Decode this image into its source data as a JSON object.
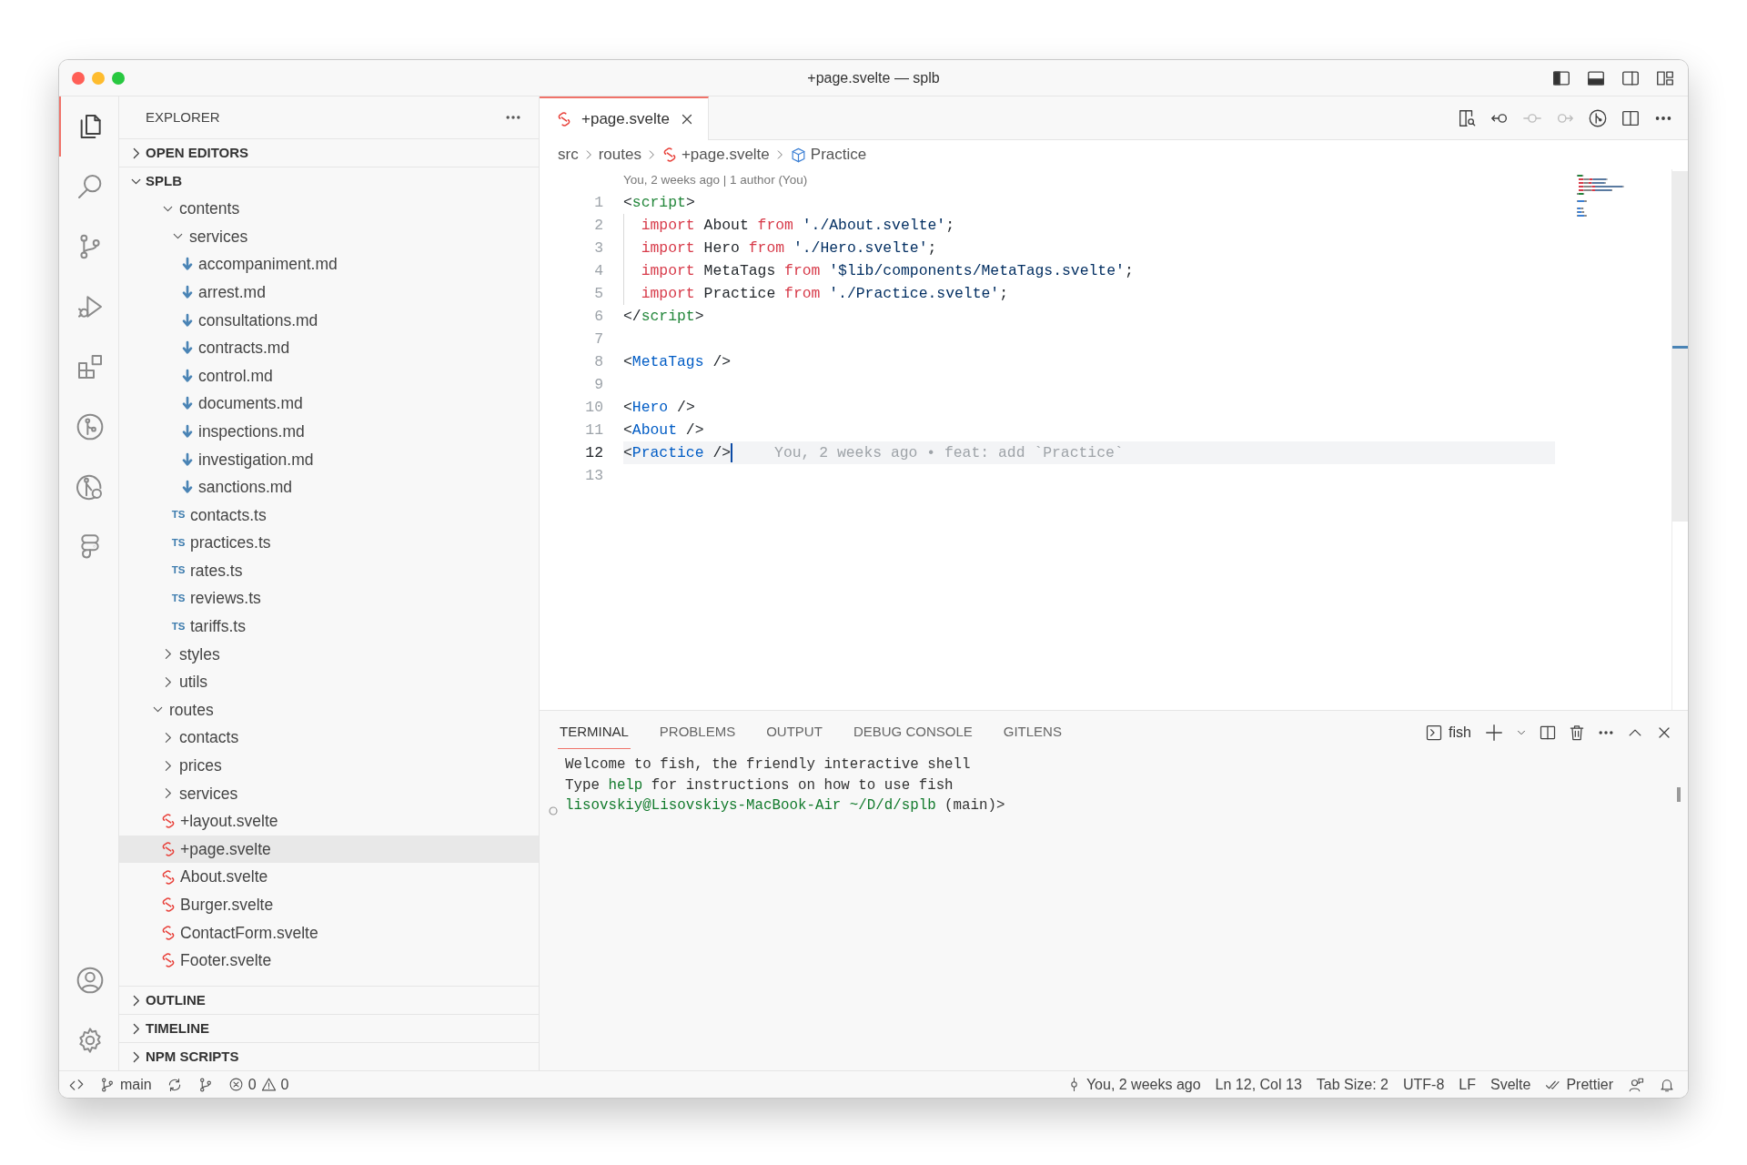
{
  "window": {
    "title": "+page.svelte — splb",
    "controls": [
      {
        "kind": "close"
      },
      {
        "kind": "minimize"
      },
      {
        "kind": "zoom"
      }
    ],
    "layout_actions": [
      {
        "kind": "sidebar",
        "on": true
      },
      {
        "kind": "panel",
        "on": true
      },
      {
        "kind": "secondary",
        "on": false
      },
      {
        "kind": "customize"
      }
    ]
  },
  "activity_bar": {
    "items": [
      {
        "kind": "explorer",
        "selected": true
      },
      {
        "kind": "search",
        "selected": false
      },
      {
        "kind": "source-control",
        "selected": false
      },
      {
        "kind": "run",
        "selected": false
      },
      {
        "kind": "extensions",
        "selected": false
      },
      {
        "kind": "git-graph",
        "selected": false
      },
      {
        "kind": "remote",
        "selected": false
      },
      {
        "kind": "shapes",
        "selected": false
      }
    ],
    "bottom": [
      {
        "kind": "account"
      },
      {
        "kind": "settings"
      }
    ]
  },
  "sidebar": {
    "title": "EXPLORER",
    "sections": [
      {
        "label": "OPEN EDITORS",
        "expanded": false
      },
      {
        "label": "SPLB",
        "expanded": true,
        "tree": [
          {
            "children": [
              {
                "label": "contents",
                "kind": "folder",
                "expanded": true,
                "selected": false,
                "children": [
                  {
                    "label": "services",
                    "kind": "folder",
                    "expanded": true,
                    "selected": false,
                    "children": [
                      {
                        "label": "accompaniment.md",
                        "kind": "markdown",
                        "selected": false
                      },
                      {
                        "label": "arrest.md",
                        "kind": "markdown",
                        "selected": false
                      },
                      {
                        "label": "consultations.md",
                        "kind": "markdown",
                        "selected": false
                      },
                      {
                        "label": "contracts.md",
                        "kind": "markdown",
                        "selected": false
                      },
                      {
                        "label": "control.md",
                        "kind": "markdown",
                        "selected": false
                      },
                      {
                        "label": "documents.md",
                        "kind": "markdown",
                        "selected": false
                      },
                      {
                        "label": "inspections.md",
                        "kind": "markdown",
                        "selected": false
                      },
                      {
                        "label": "investigation.md",
                        "kind": "markdown",
                        "selected": false
                      },
                      {
                        "label": "sanctions.md",
                        "kind": "markdown",
                        "selected": false
                      }
                    ]
                  },
                  {
                    "label": "contacts.ts",
                    "kind": "typescript",
                    "badge": "TS",
                    "selected": false
                  },
                  {
                    "label": "practices.ts",
                    "kind": "typescript",
                    "badge": "TS",
                    "selected": false
                  },
                  {
                    "label": "rates.ts",
                    "kind": "typescript",
                    "badge": "TS",
                    "selected": false
                  },
                  {
                    "label": "reviews.ts",
                    "kind": "typescript",
                    "badge": "TS",
                    "selected": false
                  },
                  {
                    "label": "tariffs.ts",
                    "kind": "typescript",
                    "badge": "TS",
                    "selected": false
                  }
                ]
              },
              {
                "label": "styles",
                "kind": "folder",
                "expanded": false,
                "selected": false
              },
              {
                "label": "utils",
                "kind": "folder",
                "expanded": false,
                "selected": false
              }
            ]
          },
          {
            "label": "routes",
            "kind": "folder",
            "expanded": true,
            "selected": false,
            "children": [
              {
                "label": "contacts",
                "kind": "folder",
                "expanded": false,
                "selected": false
              },
              {
                "label": "prices",
                "kind": "folder",
                "expanded": false,
                "selected": false
              },
              {
                "label": "services",
                "kind": "folder",
                "expanded": false,
                "selected": false
              },
              {
                "label": "+layout.svelte",
                "kind": "svelte",
                "selected": false
              },
              {
                "label": "+page.svelte",
                "kind": "svelte",
                "selected": true
              },
              {
                "label": "About.svelte",
                "kind": "svelte",
                "selected": false
              },
              {
                "label": "Burger.svelte",
                "kind": "svelte",
                "selected": false
              },
              {
                "label": "ContactForm.svelte",
                "kind": "svelte",
                "selected": false
              },
              {
                "label": "Footer.svelte",
                "kind": "svelte",
                "selected": false
              }
            ]
          }
        ]
      },
      {
        "label": "OUTLINE",
        "expanded": false
      },
      {
        "label": "TIMELINE",
        "expanded": false
      },
      {
        "label": "NPM SCRIPTS",
        "expanded": false
      }
    ]
  },
  "editor": {
    "tabs": [
      {
        "label": "+page.svelte",
        "kind": "svelte",
        "selected": true
      }
    ],
    "actions": [
      {
        "kind": "preview",
        "disabled": false
      },
      {
        "kind": "back",
        "disabled": false
      },
      {
        "kind": "commit",
        "disabled": true
      },
      {
        "kind": "forward",
        "disabled": true
      },
      {
        "kind": "gitlens",
        "disabled": false
      },
      {
        "kind": "split",
        "disabled": false
      },
      {
        "kind": "more",
        "disabled": false
      }
    ],
    "breadcrumbs": [
      {
        "label": "src",
        "kind": "folder"
      },
      {
        "label": "routes",
        "kind": "folder"
      },
      {
        "label": "+page.svelte",
        "kind": "svelte"
      },
      {
        "label": "Practice",
        "kind": "component"
      }
    ],
    "blame_header": "You, 2 weeks ago | 1 author (You)",
    "lines": [
      {
        "number": "1",
        "indent": false,
        "current": false,
        "tokens": [
          {
            "kind": "punct",
            "text": "<"
          },
          {
            "kind": "tag",
            "text": "script"
          },
          {
            "kind": "punct",
            "text": ">"
          }
        ]
      },
      {
        "number": "2",
        "indent": true,
        "current": false,
        "tokens": [
          {
            "kind": "keyword",
            "text": "import"
          },
          {
            "kind": "name",
            "text": " About "
          },
          {
            "kind": "keyword",
            "text": "from"
          },
          {
            "kind": "string",
            "text": " './About.svelte'"
          },
          {
            "kind": "punct",
            "text": ";"
          }
        ]
      },
      {
        "number": "3",
        "indent": true,
        "current": false,
        "tokens": [
          {
            "kind": "keyword",
            "text": "import"
          },
          {
            "kind": "name",
            "text": " Hero "
          },
          {
            "kind": "keyword",
            "text": "from"
          },
          {
            "kind": "string",
            "text": " './Hero.svelte'"
          },
          {
            "kind": "punct",
            "text": ";"
          }
        ]
      },
      {
        "number": "4",
        "indent": true,
        "current": false,
        "tokens": [
          {
            "kind": "keyword",
            "text": "import"
          },
          {
            "kind": "name",
            "text": " MetaTags "
          },
          {
            "kind": "keyword",
            "text": "from"
          },
          {
            "kind": "string",
            "text": " '$lib/components/MetaTags.svelte'"
          },
          {
            "kind": "punct",
            "text": ";"
          }
        ]
      },
      {
        "number": "5",
        "indent": true,
        "current": false,
        "tokens": [
          {
            "kind": "keyword",
            "text": "import"
          },
          {
            "kind": "name",
            "text": " Practice "
          },
          {
            "kind": "keyword",
            "text": "from"
          },
          {
            "kind": "string",
            "text": " './Practice.svelte'"
          },
          {
            "kind": "punct",
            "text": ";"
          }
        ]
      },
      {
        "number": "6",
        "indent": false,
        "current": false,
        "tokens": [
          {
            "kind": "punct",
            "text": "</"
          },
          {
            "kind": "tag",
            "text": "script"
          },
          {
            "kind": "punct",
            "text": ">"
          }
        ]
      },
      {
        "number": "7",
        "indent": false,
        "current": false
      },
      {
        "number": "8",
        "indent": false,
        "current": false,
        "tokens": [
          {
            "kind": "punct",
            "text": "<"
          },
          {
            "kind": "component",
            "text": "MetaTags"
          },
          {
            "kind": "punct",
            "text": " />"
          }
        ]
      },
      {
        "number": "9",
        "indent": false,
        "current": false
      },
      {
        "number": "10",
        "indent": false,
        "current": false,
        "tokens": [
          {
            "kind": "punct",
            "text": "<"
          },
          {
            "kind": "component",
            "text": "Hero"
          },
          {
            "kind": "punct",
            "text": " />"
          }
        ]
      },
      {
        "number": "11",
        "indent": false,
        "current": false,
        "tokens": [
          {
            "kind": "punct",
            "text": "<"
          },
          {
            "kind": "component",
            "text": "About"
          },
          {
            "kind": "punct",
            "text": " />"
          }
        ]
      },
      {
        "number": "12",
        "indent": false,
        "current": true,
        "blame": "You, 2 weeks ago • feat: add `Practice`",
        "tokens": [
          {
            "kind": "punct",
            "text": "<"
          },
          {
            "kind": "component",
            "text": "Practice"
          },
          {
            "kind": "punct",
            "text": " />"
          }
        ]
      },
      {
        "number": "13",
        "indent": false,
        "current": false
      }
    ]
  },
  "panel": {
    "tabs": [
      {
        "label": "TERMINAL",
        "selected": true
      },
      {
        "label": "PROBLEMS",
        "selected": false
      },
      {
        "label": "OUTPUT",
        "selected": false
      },
      {
        "label": "DEBUG CONSOLE",
        "selected": false
      },
      {
        "label": "GITLENS",
        "selected": false
      }
    ],
    "shell": "fish",
    "actions": [
      {
        "kind": "add"
      },
      {
        "kind": "dropdown"
      },
      {
        "kind": "split"
      },
      {
        "kind": "trash"
      },
      {
        "kind": "more"
      },
      {
        "kind": "maximize"
      },
      {
        "kind": "close"
      }
    ],
    "terminal": [
      {
        "kind": "output",
        "segments": [
          {
            "kind": "plain",
            "text": "Welcome to fish, the friendly interactive shell"
          }
        ]
      },
      {
        "kind": "output",
        "segments": [
          {
            "kind": "plain",
            "text": "Type "
          },
          {
            "kind": "green",
            "text": "help"
          },
          {
            "kind": "plain",
            "text": " for instructions on how to use fish"
          }
        ]
      },
      {
        "kind": "prompt",
        "segments": [
          {
            "kind": "green",
            "text": "lisovskiy@Lisovskiys-MacBook-Air"
          },
          {
            "kind": "green",
            "text": " ~/D/d/splb"
          },
          {
            "kind": "plain",
            "text": " (main)>"
          }
        ]
      }
    ]
  },
  "status_bar": {
    "left": [
      {
        "kind": "remote"
      },
      {
        "kind": "branch",
        "text": "main"
      },
      {
        "kind": "sync"
      },
      {
        "kind": "graph"
      },
      {
        "kind": "problems",
        "errors": "0",
        "warnings": "0"
      }
    ],
    "right": [
      {
        "kind": "blame",
        "text": "You, 2 weeks ago"
      },
      {
        "kind": "text",
        "text": "Ln 12, Col 13"
      },
      {
        "kind": "text",
        "text": "Tab Size: 2"
      },
      {
        "kind": "text",
        "text": "UTF-8"
      },
      {
        "kind": "text",
        "text": "LF"
      },
      {
        "kind": "text",
        "text": "Svelte"
      },
      {
        "kind": "prettier",
        "text": "Prettier"
      },
      {
        "kind": "feedback"
      },
      {
        "kind": "bell"
      }
    ]
  }
}
